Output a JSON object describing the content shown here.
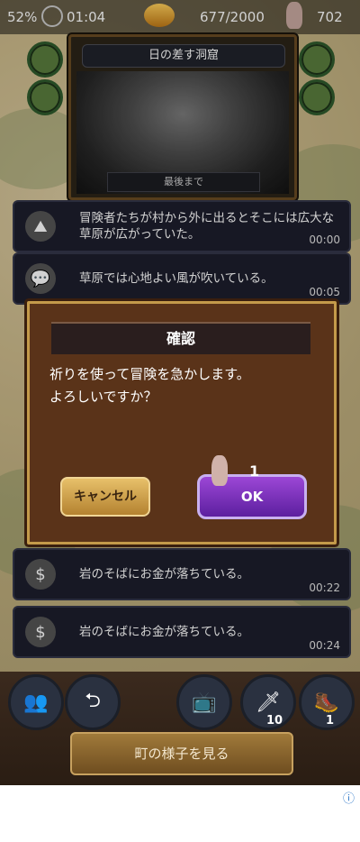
{
  "status": {
    "battery": "52%",
    "time": "01:04",
    "coins": "677/2000",
    "prayers": "702"
  },
  "event": {
    "title": "日の差す洞窟",
    "footer": "最後まで"
  },
  "logs": [
    {
      "icon": "mountain-icon",
      "text": "冒険者たちが村から外に出るとそこには広大な草原が広がっていた。",
      "time": "00:00"
    },
    {
      "icon": "speech-bubble-icon",
      "text": "草原では心地よい風が吹いている。",
      "time": "00:05"
    },
    {
      "icon": "money-bag-icon",
      "text": "岩のそばにお金が落ちている。",
      "time": "00:22"
    },
    {
      "icon": "money-bag-icon",
      "text": "岩のそばにお金が落ちている。",
      "time": "00:24"
    }
  ],
  "dialog": {
    "title": "確認",
    "message": "祈りを使って冒険を急かします。\nよろしいですか？",
    "cancel_label": "キャンセル",
    "ok_label": "OK",
    "cost": "1"
  },
  "bottom": {
    "counts": {
      "sword": "10",
      "boot": "1"
    },
    "town_button": "町の様子を見る"
  },
  "ad": {
    "info": "ⓘ"
  }
}
